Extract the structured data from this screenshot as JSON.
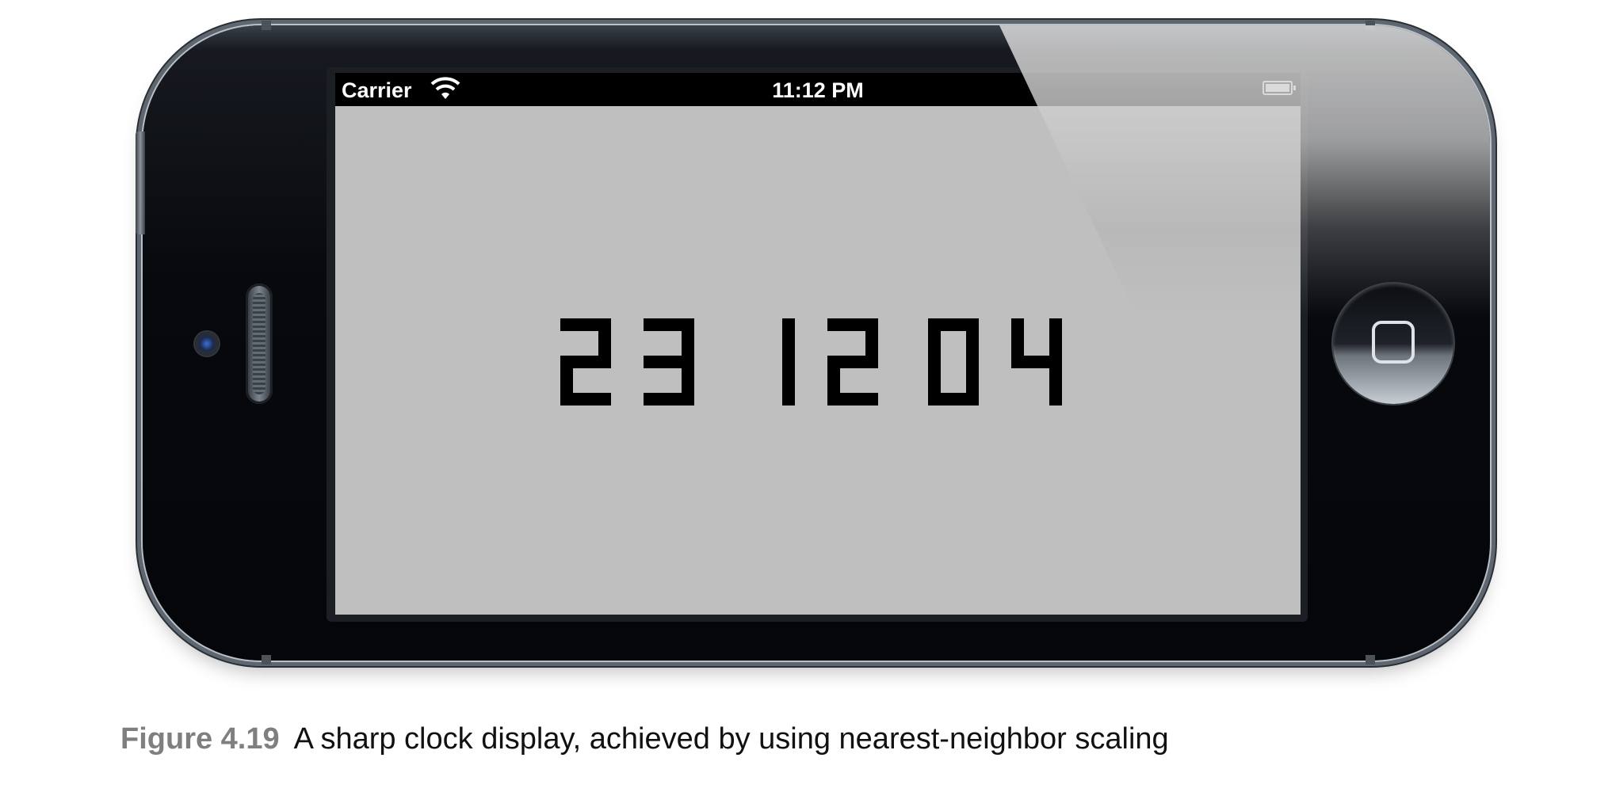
{
  "status_bar": {
    "carrier": "Carrier",
    "time": "11:12 PM"
  },
  "clock": {
    "digits": [
      "2",
      "3",
      "1",
      "2",
      "0",
      "4"
    ],
    "display_text": "231204",
    "digit_color": "#000000",
    "background_color": "#bfbfbf"
  },
  "caption": {
    "figure_label": "Figure 4.19",
    "text": "A sharp clock display, achieved by using nearest-neighbor scaling"
  },
  "icons": {
    "wifi": "wifi-icon",
    "battery": "battery-icon",
    "camera": "front-camera",
    "speaker": "earpiece-speaker",
    "home": "home-button"
  }
}
